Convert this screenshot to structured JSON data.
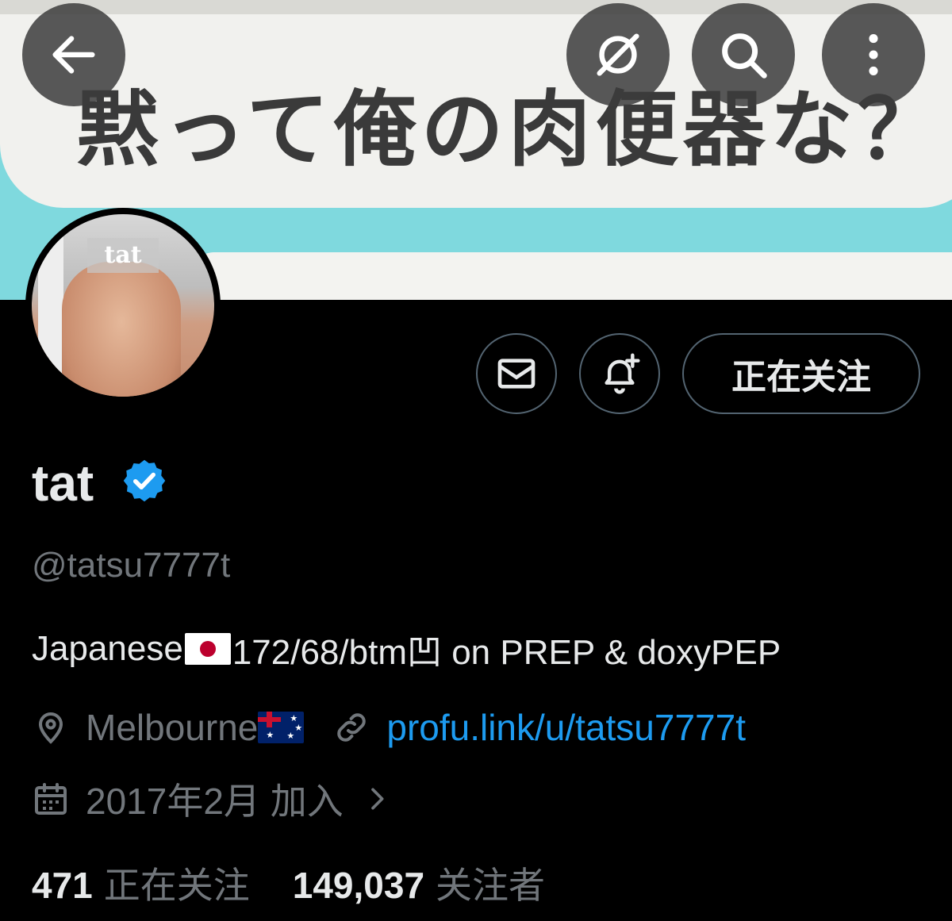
{
  "banner": {
    "headline": "黙って俺の肉便器な？"
  },
  "top_bar": {
    "back_icon": "arrow-left-icon",
    "grok_icon": "grok-icon",
    "search_icon": "search-icon",
    "more_icon": "more-vertical-icon"
  },
  "avatar": {
    "overlay_text": "tat"
  },
  "actions": {
    "follow_label": "正在关注"
  },
  "profile": {
    "display_name": "tat",
    "handle": "@tatsu7777t",
    "bio_prefix": "Japanese",
    "bio_suffix": "172/68/btm凹 on PREP & doxyPEP",
    "location": "Melbourne",
    "website": "profu.link/u/tatsu7777t",
    "joined": "2017年2月 加入"
  },
  "stats": {
    "following_count": "471",
    "following_label": "正在关注",
    "followers_count": "149,037",
    "followers_label": "关注者"
  },
  "colors": {
    "background": "#000000",
    "text_primary": "#e7e9ea",
    "text_secondary": "#71767b",
    "link": "#1d9bf0",
    "verified": "#1d9bf0",
    "border": "#536471"
  }
}
